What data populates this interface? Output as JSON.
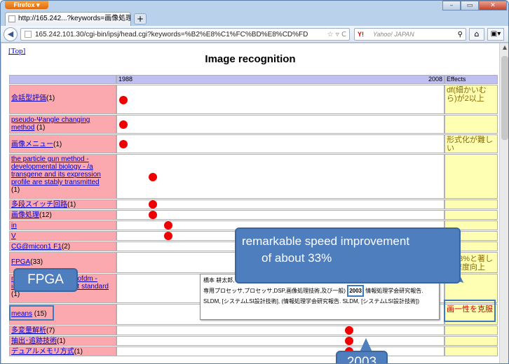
{
  "browser": {
    "app_button": "Firefox ▾",
    "tab_title": "http://165.242...?keywords=画像処理",
    "new_tab": "+",
    "url": "165.242.101.30/cgi-bin/ipsj/head.cgi?keywords=%B2%E8%C1%FC%BD%E8%CD%FD",
    "search_placeholder": "Yahoo! JAPAN",
    "search_brand": "Y!",
    "window_buttons": [
      "–",
      "▭",
      "✕"
    ]
  },
  "page": {
    "top_link": "[Top]",
    "title": "Image recognition",
    "header": {
      "start_year": "1988",
      "end_year": "2008",
      "effects": "Effects"
    },
    "rows": [
      {
        "label": "会話型評価",
        "count": "(1)",
        "effect": "df(細かいむら)が2以上"
      },
      {
        "label": "pseudo-Ψangle changing method",
        "count": " (1)",
        "effect": ""
      },
      {
        "label": "画像メニュー",
        "count": "(1)",
        "effect": "形式化が難しい"
      },
      {
        "label": "the particle gun method - developmental biology - /a transgene and its expression profile are stably transmitted",
        "count": "(1)",
        "effect": ""
      },
      {
        "label": "多段スイッチ回路",
        "count": "(1)",
        "effect": ""
      },
      {
        "label": "画像処理",
        "count": "(12)",
        "effect": ""
      },
      {
        "label": "in",
        "count": "",
        "effect": ""
      },
      {
        "label": "V",
        "count": "",
        "effect": ""
      },
      {
        "label": "CG@micon1 F1",
        "count": "(2)",
        "effect": ""
      },
      {
        "label": "FPGA",
        "count": "(33)",
        "effect": "約33%と著しい速度向上"
      },
      {
        "label": "multiband ofdm - mb-ofdm - ieee802 . 15 . 3a draft standard",
        "count": " (1)",
        "effect": ""
      },
      {
        "label": "means",
        "count": " (15)",
        "effect": "画一性を克服"
      },
      {
        "label": "多変量解析",
        "count": "(7)",
        "effect": ""
      },
      {
        "label": "抽出･追跡技術",
        "count": "(1)",
        "effect": ""
      },
      {
        "label": "デュアルメモリ方式",
        "count": "(1)",
        "effect": ""
      }
    ],
    "tooltip": {
      "before": "橋本 耕太郎, FPGAによるDSP向け多機能メモリの実現(システムLSIの応用とその要素技術,専用プロセッサ,プロセッサ,DSP,画像処理技術,及び一般) ",
      "year": "2003",
      "after": " 情報処理学会研究報告. SLDM, [システムLSI設計技術], (情報処理学会研究報告. SLDM, [システムLSI設計技術])"
    }
  },
  "callouts": {
    "speed_line1": "remarkable speed improvement",
    "speed_line2": "of about 33%",
    "fpga": "FPGA",
    "year": "2003"
  },
  "colors": {
    "label_bg": "#fba8ae",
    "effect_bg": "#ffffb4",
    "header_bg": "#c0c0f0",
    "dot": "#e00000",
    "callout": "#4f7ebf"
  }
}
